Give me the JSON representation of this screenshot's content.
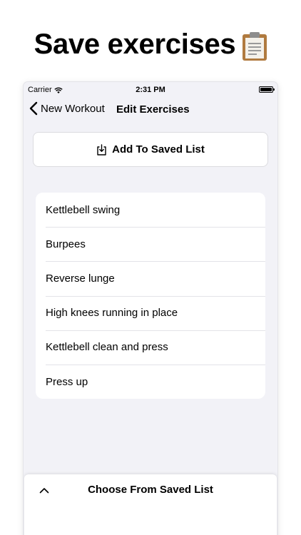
{
  "headline": "Save exercises",
  "status_bar": {
    "carrier": "Carrier",
    "time": "2:31 PM"
  },
  "nav": {
    "back_label": "New Workout",
    "title": "Edit Exercises"
  },
  "add_button": {
    "label": "Add To Saved List"
  },
  "exercises": [
    "Kettlebell swing",
    "Burpees",
    "Reverse lunge",
    "High knees running in place",
    "Kettlebell clean and press",
    "Press up"
  ],
  "bottom_sheet": {
    "title": "Choose From Saved List"
  },
  "icons": {
    "headline_icon": "clipboard-icon",
    "back": "chevron-left-icon",
    "add": "download-tray-icon",
    "sheet_toggle": "chevron-up-icon"
  }
}
